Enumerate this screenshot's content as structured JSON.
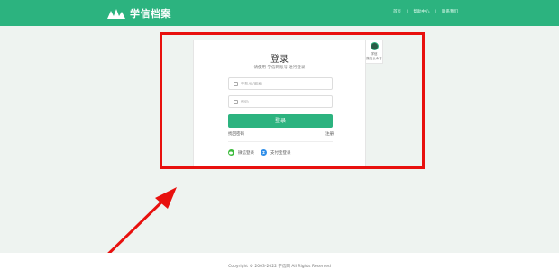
{
  "header": {
    "logo_text": "学信档案",
    "nav": [
      "首页",
      "帮助中心",
      "联系我们"
    ]
  },
  "login": {
    "title": "登录",
    "subtitle": "请使用 学信网账号 进行登录",
    "phone_placeholder": "手机号/邮箱",
    "password_placeholder": "密码",
    "button_label": "登录",
    "forgot_label": "找回密码",
    "register_label": "注册",
    "wechat_label": "微信登录",
    "alipay_label": "支付宝登录"
  },
  "side": {
    "line1": "学信",
    "line2": "微信公众号"
  },
  "footer": {
    "copyright": "Copyright © 2003-2022 学信网 All Rights Reserved"
  },
  "colors": {
    "brand": "#2cb37f",
    "annotation": "#e8100e",
    "wechat": "#3cbb3c",
    "alipay": "#2f8ee8"
  }
}
